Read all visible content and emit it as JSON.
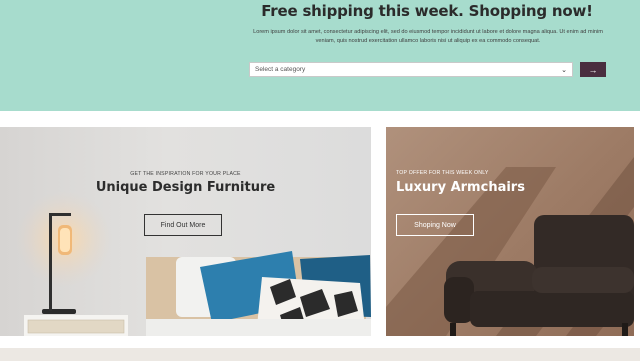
{
  "hero": {
    "title": "Free shipping this week. Shopping now!",
    "description": "Lorem ipsum dolor sit amet, consectetur adipiscing elit, sed do eiusmod tempor incididunt ut labore et dolore magna aliqua. Ut enim ad minim veniam, quis nostrud exercitation ullamco laboris nisi ut aliquip ex ea commodo consequat.",
    "select_placeholder": "Select a category",
    "go_icon": "→",
    "background_color": "#a7dccd",
    "button_color": "#4a2e3f"
  },
  "promos": {
    "left": {
      "subtitle": "GET THE INSPIRATION FOR YOUR PLACE",
      "title": "Unique Design Furniture",
      "button_label": "Find Out More"
    },
    "right": {
      "subtitle": "TOP OFFER FOR THIS WEEK ONLY",
      "title": "Luxury Armchairs",
      "button_label": "Shoping Now"
    }
  }
}
